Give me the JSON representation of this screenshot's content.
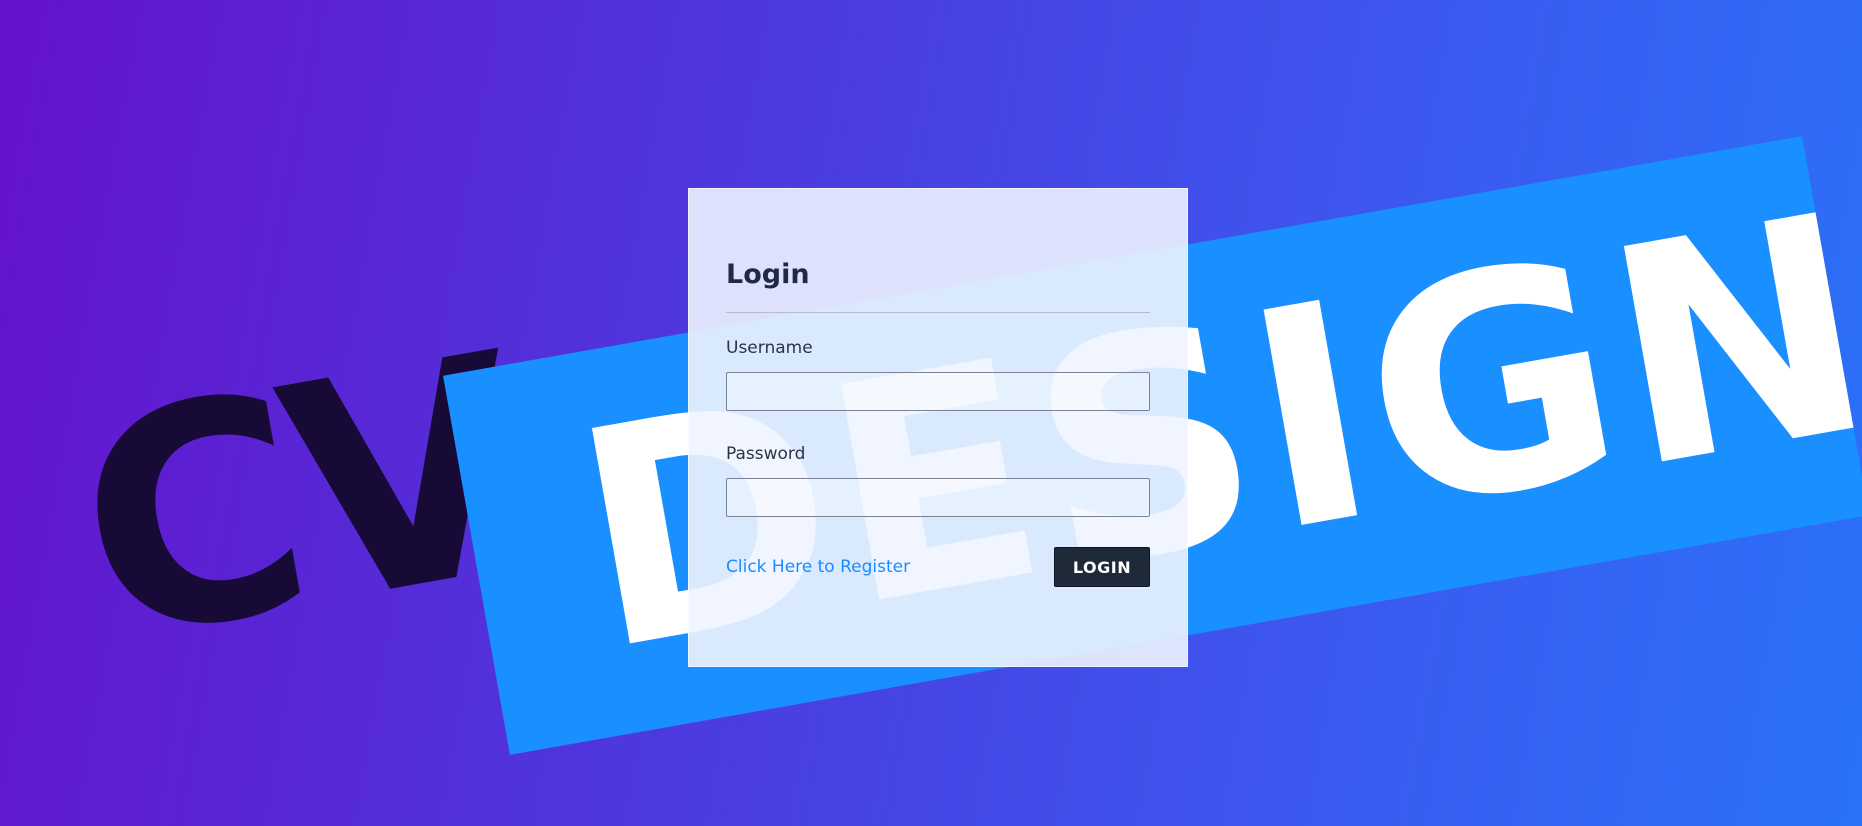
{
  "brand": {
    "prefix": "CV",
    "word": "DESIGN"
  },
  "login": {
    "title": "Login",
    "username_label": "Username",
    "username_value": "",
    "password_label": "Password",
    "password_value": "",
    "register_link": "Click Here to Register",
    "submit_label": "LOGIN"
  },
  "colors": {
    "gradient_start": "#6512cc",
    "gradient_end": "#2a72f8",
    "band": "#1a8fff",
    "cv_text": "#170a37",
    "button": "#1f2a38",
    "link": "#1c8bff"
  }
}
